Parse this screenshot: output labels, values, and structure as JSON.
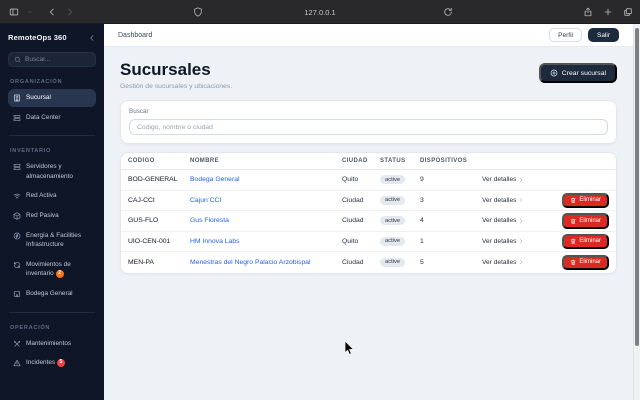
{
  "browser": {
    "url": "127.0.0.1",
    "icons": [
      "sidebar-toggle-icon",
      "chevron-down-icon",
      "back-icon",
      "forward-icon",
      "shield-icon",
      "reload-icon",
      "share-icon",
      "new-tab-icon",
      "tabs-overview-icon"
    ]
  },
  "sidebar": {
    "title": "RemoteOps 360",
    "collapse_icon": "chevron-left-icon",
    "search_placeholder": "Buscar...",
    "sections": [
      {
        "label": "ORGANIZACIÓN",
        "items": [
          {
            "label": "Sucursal",
            "icon": "building-icon",
            "active": true
          },
          {
            "label": "Data Center",
            "icon": "server-icon",
            "active": false
          }
        ]
      },
      {
        "label": "INVENTARIO",
        "items": [
          {
            "label": "Servidores y almacenamiento",
            "icon": "server-icon",
            "active": false
          },
          {
            "label": "Red Activa",
            "icon": "wifi-icon",
            "active": false
          },
          {
            "label": "Red Pasiva",
            "icon": "box-icon",
            "active": false
          },
          {
            "label": "Energía & Facilities Infrastructure",
            "icon": "energy-icon",
            "active": false
          },
          {
            "label": "Movimientos de inventario",
            "icon": "refresh-icon",
            "active": false,
            "badge": "2",
            "badge_color": "#f97316"
          },
          {
            "label": "Bodega General",
            "icon": "store-icon",
            "active": false
          }
        ]
      },
      {
        "label": "OPERACIÓN",
        "items": [
          {
            "label": "Mantenimientos",
            "icon": "tools-icon",
            "active": false
          },
          {
            "label": "Incidentes",
            "icon": "warning-icon",
            "active": false,
            "badge": "5",
            "badge_color": "#ef4444"
          }
        ]
      }
    ]
  },
  "topbar": {
    "breadcrumb": "Dashboard",
    "profile_label": "Perfil",
    "logout_label": "Salir"
  },
  "page": {
    "title": "Sucursales",
    "subtitle": "Gestión de sucursales y ubicaciones.",
    "create_button": "Crear sucursal",
    "search_label": "Buscar",
    "search_placeholder": "Codigo, nombre o ciudad"
  },
  "table": {
    "headers": [
      "CODIGO",
      "NOMBRE",
      "CIUDAD",
      "STATUS",
      "DISPOSITIVOS"
    ],
    "details_label": "Ver detalles",
    "delete_label": "Eliminar",
    "rows": [
      {
        "code": "BOD-GENERAL",
        "name": "Bodega General",
        "city": "Quito",
        "status": "active",
        "devices": "9",
        "deletable": false
      },
      {
        "code": "CAJ-CCI",
        "name": "Cajun CCI",
        "city": "Ciudad",
        "status": "active",
        "devices": "3",
        "deletable": true
      },
      {
        "code": "GUS-FLO",
        "name": "Gus Floresta",
        "city": "Ciudad",
        "status": "active",
        "devices": "4",
        "deletable": true
      },
      {
        "code": "UIO-CEN-001",
        "name": "HM Innova Labs",
        "city": "Quito",
        "status": "active",
        "devices": "1",
        "deletable": true
      },
      {
        "code": "MEN-PA",
        "name": "Menestras del Negro Palacio Arzobispal",
        "city": "Ciudad",
        "status": "active",
        "devices": "5",
        "deletable": true
      }
    ]
  },
  "colors": {
    "sidebar_bg": "#0e1627",
    "sidebar_active_bg": "#283650",
    "accent_dark": "#1d2a3e",
    "link_blue": "#2563eb",
    "danger_red": "#da2a22",
    "badge_orange": "#f97316",
    "badge_red": "#ef4444",
    "status_pill_bg": "#e4e8ef",
    "content_bg": "#eef1f6"
  }
}
